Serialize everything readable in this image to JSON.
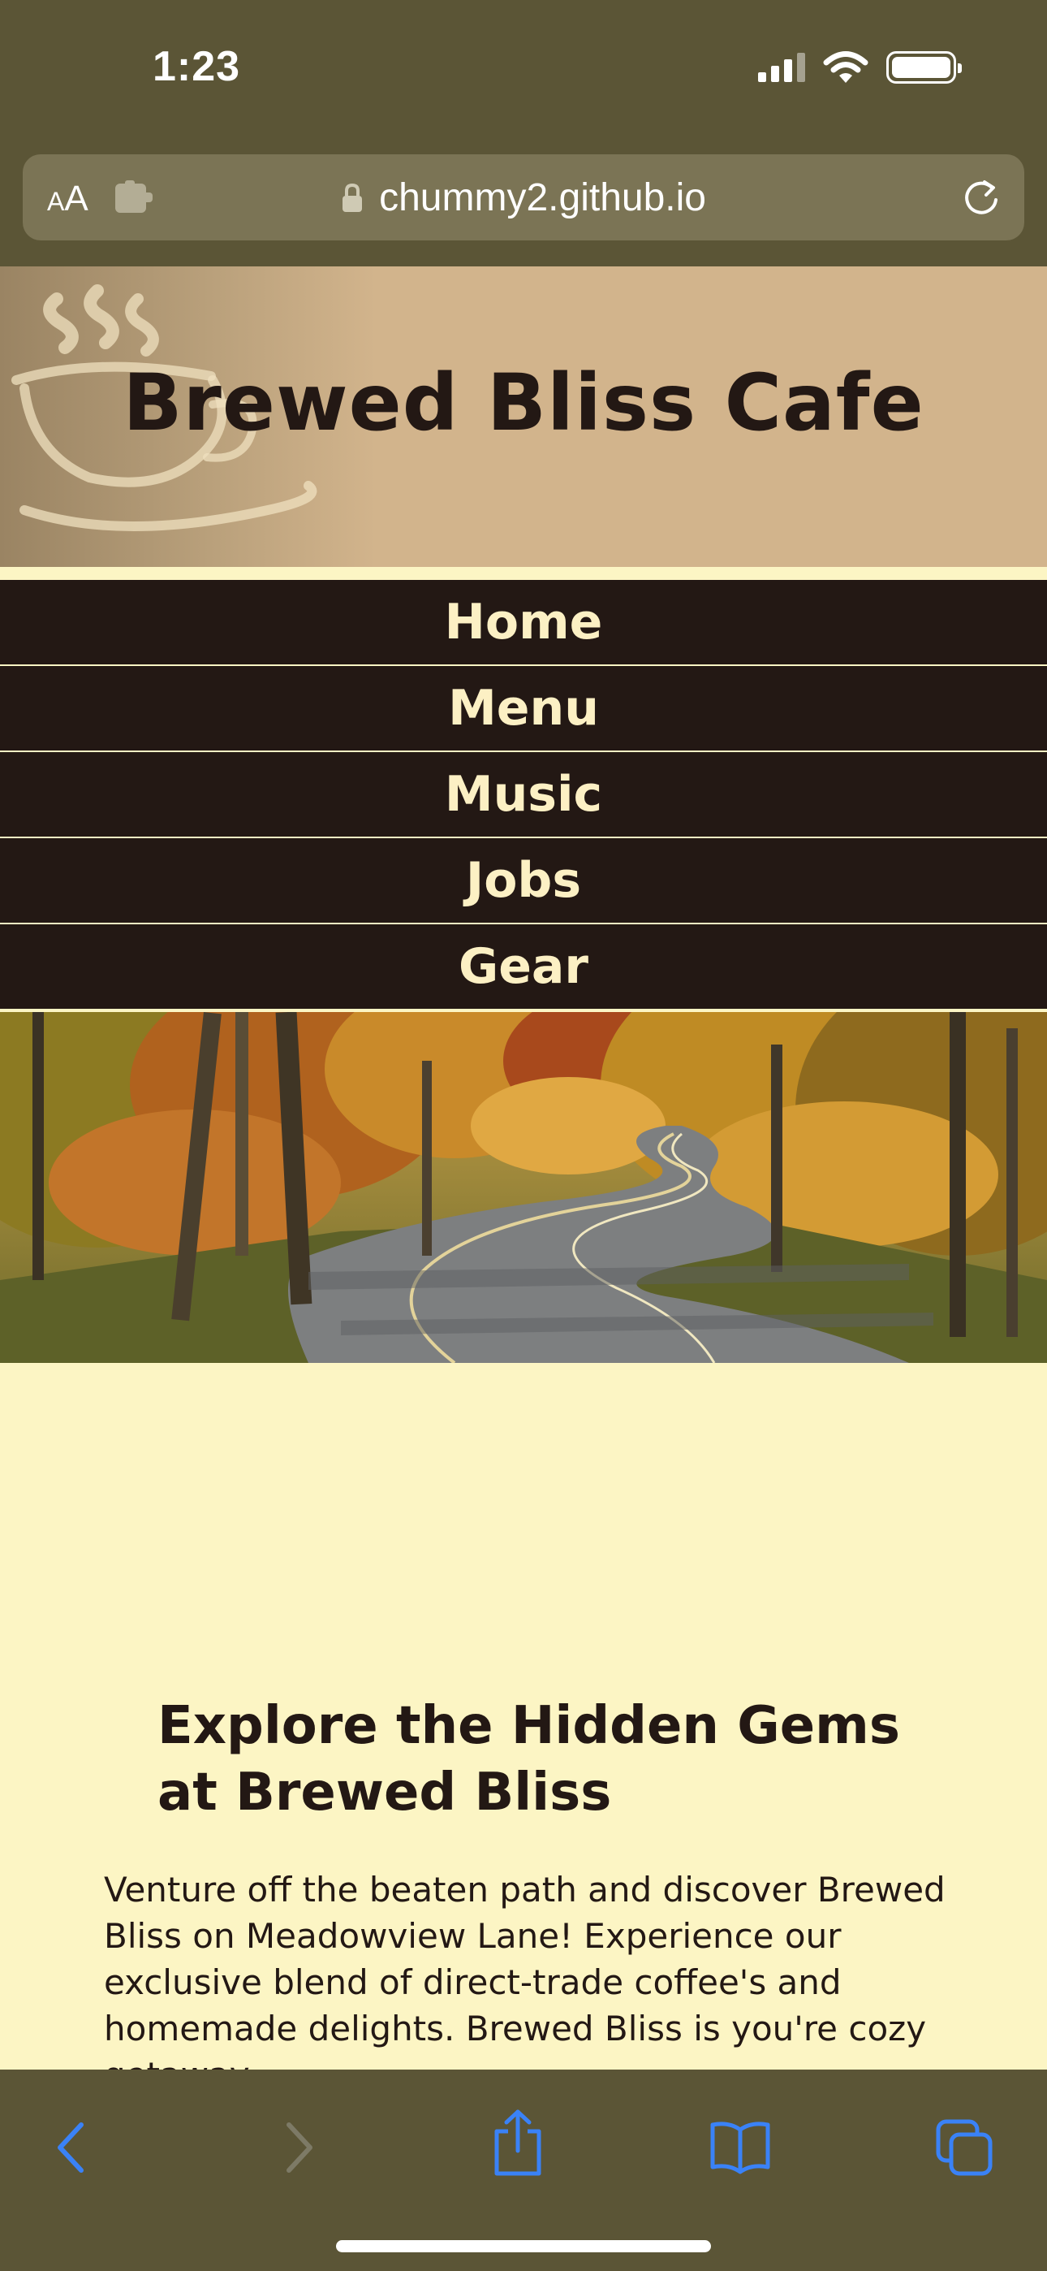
{
  "status_bar": {
    "time": "1:23",
    "icons": [
      "signal-icon",
      "wifi-icon",
      "battery-icon"
    ]
  },
  "browser": {
    "text_size_small": "A",
    "text_size_big": "A",
    "url": "chummy2.github.io",
    "icons": [
      "text-size-icon",
      "extension-icon",
      "lock-icon",
      "reload-icon"
    ]
  },
  "site": {
    "title": "Brewed Bliss Cafe",
    "nav": [
      {
        "label": "Home"
      },
      {
        "label": "Menu"
      },
      {
        "label": "Music"
      },
      {
        "label": "Jobs"
      },
      {
        "label": "Gear"
      }
    ],
    "heading": "Explore the Hidden Gems at Brewed Bliss",
    "paragraph": "Venture off the beaten path and discover Brewed Bliss on Meadowview Lane! Experience our exclusive blend of direct-trade coffee's and homemade delights. Brewed Bliss is you're cozy  getaway..."
  },
  "toolbar": {
    "icons": [
      "back-icon",
      "forward-icon",
      "share-icon",
      "bookmarks-icon",
      "tabs-icon"
    ]
  },
  "colors": {
    "chrome": "#5b5536",
    "url_bar": "#7b7455",
    "header_tan": "#d2b48c",
    "nav_dark": "#231814",
    "nav_text": "#fcf0c4",
    "page_bg": "#fcf5c4",
    "ios_blue": "#3a82f7"
  }
}
